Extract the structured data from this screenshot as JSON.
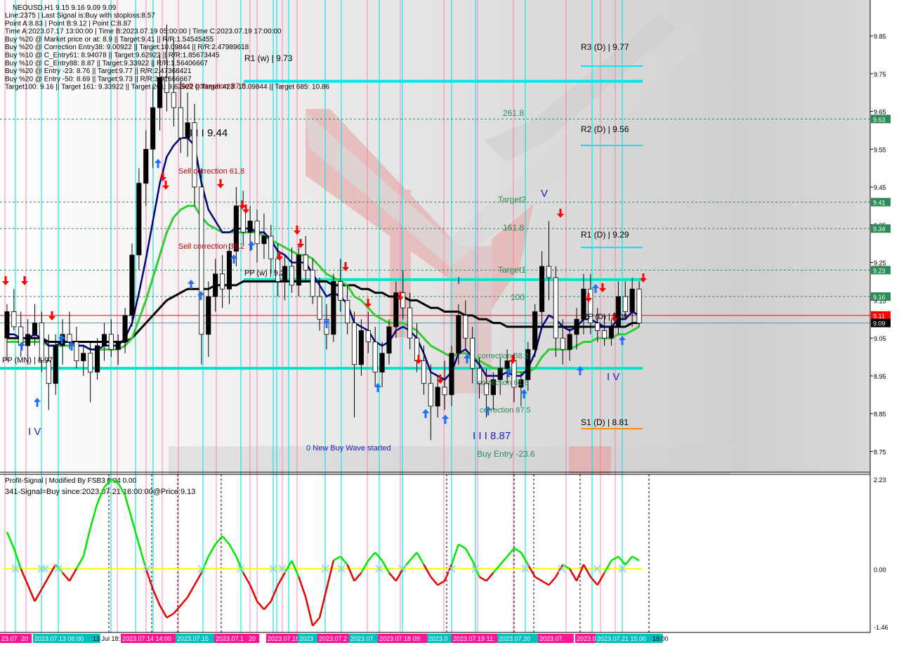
{
  "header": {
    "symbol_line": "NEOUSD,H1  9.15 9.16 9.09 9.09",
    "lines": [
      "Line:2375 | Last Signal is:Buy with stoploss:8.57",
      "Point A:8.83 | Point B:9.12 | Point C:8.87",
      "Time A:2023.07.17 13:00:00 | Time B:2023.07.19 05:00:00 | Time C:2023.07.19 17:00:00",
      "Buy %20 @ Market price or at: 8.9 || Target:9.41 || R/R:1.54545455",
      "Buy %20 @ Correction Entry38: 9.00922 || Target:10.09844 || R/R:2.47989618",
      "Buy %10 @ C_Entry61: 8.94078 || Target:9.62922 || R/R:1.85673445",
      "Buy %10 @ C_Entry88: 8.87 || Target:9.33922 || R/R:1.56406667",
      "Buy %20 @ Entry -23: 8.76 || Target:9.77 || R/R:2.47368421",
      "Buy %20 @ Entry -50: 8.69 || Target:9.73 || R/R:3.91666667",
      "Target100: 9.16 || Target 161: 9.33922 || Target 261: 9.62922 || Target 423: 10.09844 || Target 685: 10.86"
    ]
  },
  "colors": {
    "up": "#ff0000",
    "down": "#ffff00",
    "osc_zero": "#ffff00",
    "pivot": "#00e5ee",
    "pp_line": "#00e5c8",
    "ema_fast": "#000080",
    "ema_mid": "#32cd32",
    "ema_slow": "#000000",
    "fib": "#2e8b57",
    "cyan_vline": "#00e5ee",
    "pink_vline": "#ff69b4"
  },
  "price_axis": {
    "ticks": [
      "9.85",
      "9.75",
      "9.65",
      "9.55",
      "9.45",
      "9.35",
      "9.25",
      "9.15",
      "9.05",
      "8.95",
      "8.85",
      "8.75"
    ],
    "badges": [
      {
        "label": "9.63",
        "price": 9.63,
        "color": "#2e8b57"
      },
      {
        "label": "9.41",
        "price": 9.41,
        "color": "#2e8b57"
      },
      {
        "label": "9.34",
        "price": 9.34,
        "color": "#2e8b57"
      },
      {
        "label": "9.23",
        "price": 9.23,
        "color": "#2e8b57"
      },
      {
        "label": "9.16",
        "price": 9.16,
        "color": "#2e8b57"
      },
      {
        "label": "9.11",
        "price": 9.11,
        "color": "#ff0000"
      },
      {
        "label": "9.09",
        "price": 9.09,
        "color": "#000000"
      }
    ]
  },
  "levels": {
    "r3": "R3 (D) | 9.77",
    "r2": "R2 (D) | 9.56",
    "r1d": "R1 (D) | 9.29",
    "s1": "S1 (D) | 8.81",
    "r1w": "R1 (w) | 9.73",
    "pp_mn": "PP (MN) | 8.97",
    "pp_w": "PP (w) | 9.2",
    "pp_d": "PP (D) | 9.08"
  },
  "labels": {
    "fib261": "261.8",
    "target2": "Target2",
    "fib161": "161.8",
    "target1": "Target1",
    "fib100": "100",
    "wave_iii": "I I I 9.44",
    "wave_iii_b": "I I I 8.87",
    "wave_iv_left": "I V",
    "wave_iv_right": "I V",
    "wave_v": "V",
    "wave_i": "I",
    "sell_corr_875": "Sell correction 87.5",
    "sell_corr_618": "Sell correction 61.8",
    "sell_corr_382": "Sell correction 38.2",
    "corr_382": "correction 38.2",
    "corr_618": "correction 61.8",
    "corr_875": "correction 87.5",
    "new_wave": "0 New Buy Wave started",
    "buy_entry": "Buy Entry -23.6"
  },
  "oscillator": {
    "title": "Profit-Signal | Modified By FSB3 0.04 0.00",
    "signal": "341-Signal=Buy since:2023.07.21 16:00:00@Price:9.13",
    "ticks": [
      "2.23",
      "0.00",
      "-1.46"
    ]
  },
  "time_axis": [
    "23.07",
    "20",
    "2023.07.13 06:00",
    "13 Jul 18:",
    "2023.07.14 14:00",
    "2023.07.15",
    "2023.07.1",
    "20",
    "2023.07.16",
    "2023",
    "2023.07.2",
    "2023.07.",
    "2023.07.18 09:",
    "2023.0",
    "2023.07.19 11:",
    "2023.07.20",
    "2023.07.",
    "2023.07",
    "2023.07.21 15:00",
    "18:00"
  ],
  "chart_data": {
    "type": "candlestick",
    "ylim": [
      8.69,
      9.95
    ],
    "ohlc": [
      [
        9.05,
        9.14,
        8.99,
        9.12
      ],
      [
        9.12,
        9.18,
        9.07,
        9.08
      ],
      [
        9.08,
        9.12,
        9.0,
        9.03
      ],
      [
        9.03,
        9.1,
        8.98,
        9.06
      ],
      [
        9.06,
        9.14,
        9.03,
        9.09
      ],
      [
        9.09,
        9.12,
        8.96,
        8.99
      ],
      [
        8.99,
        9.06,
        8.86,
        8.93
      ],
      [
        8.93,
        9.06,
        8.9,
        9.03
      ],
      [
        9.03,
        9.1,
        8.98,
        9.06
      ],
      [
        9.06,
        9.12,
        9.02,
        9.04
      ],
      [
        9.04,
        9.08,
        8.97,
        8.99
      ],
      [
        8.99,
        9.03,
        8.95,
        9.01
      ],
      [
        9.01,
        9.04,
        8.88,
        8.96
      ],
      [
        8.96,
        9.05,
        8.94,
        9.03
      ],
      [
        9.03,
        9.09,
        8.99,
        9.06
      ],
      [
        9.06,
        9.1,
        9.0,
        9.02
      ],
      [
        9.02,
        9.06,
        8.98,
        9.04
      ],
      [
        9.04,
        9.13,
        9.01,
        9.11
      ],
      [
        9.11,
        9.3,
        9.08,
        9.27
      ],
      [
        9.27,
        9.5,
        9.23,
        9.46
      ],
      [
        9.46,
        9.6,
        9.4,
        9.55
      ],
      [
        9.55,
        9.72,
        9.5,
        9.66
      ],
      [
        9.66,
        9.8,
        9.6,
        9.74
      ],
      [
        9.74,
        9.88,
        9.65,
        9.7
      ],
      [
        9.7,
        9.84,
        9.61,
        9.66
      ],
      [
        9.66,
        9.73,
        9.54,
        9.58
      ],
      [
        9.58,
        9.7,
        9.53,
        9.62
      ],
      [
        9.62,
        9.67,
        9.4,
        9.45
      ],
      [
        9.45,
        9.5,
        8.98,
        9.06
      ],
      [
        9.06,
        9.2,
        9.0,
        9.16
      ],
      [
        9.16,
        9.26,
        9.12,
        9.22
      ],
      [
        9.22,
        9.27,
        9.13,
        9.18
      ],
      [
        9.18,
        9.3,
        9.14,
        9.28
      ],
      [
        9.28,
        9.45,
        9.24,
        9.4
      ],
      [
        9.4,
        9.44,
        9.3,
        9.33
      ],
      [
        9.33,
        9.4,
        9.28,
        9.36
      ],
      [
        9.36,
        9.39,
        9.25,
        9.3
      ],
      [
        9.3,
        9.38,
        9.26,
        9.32
      ],
      [
        9.32,
        9.35,
        9.22,
        9.26
      ],
      [
        9.26,
        9.3,
        9.16,
        9.2
      ],
      [
        9.2,
        9.27,
        9.15,
        9.24
      ],
      [
        9.24,
        9.29,
        9.17,
        9.19
      ],
      [
        9.19,
        9.3,
        9.16,
        9.27
      ],
      [
        9.27,
        9.32,
        9.2,
        9.23
      ],
      [
        9.23,
        9.26,
        9.14,
        9.16
      ],
      [
        9.16,
        9.21,
        9.07,
        9.1
      ],
      [
        9.1,
        9.14,
        9.02,
        9.06
      ],
      [
        9.06,
        9.22,
        9.04,
        9.2
      ],
      [
        9.2,
        9.26,
        9.12,
        9.15
      ],
      [
        9.15,
        9.19,
        9.06,
        9.09
      ],
      [
        9.09,
        9.12,
        8.84,
        8.98
      ],
      [
        8.98,
        9.1,
        8.95,
        9.07
      ],
      [
        9.07,
        9.12,
        9.01,
        9.04
      ],
      [
        9.04,
        9.08,
        8.92,
        8.96
      ],
      [
        8.96,
        9.04,
        8.92,
        9.01
      ],
      [
        9.01,
        9.1,
        8.98,
        9.08
      ],
      [
        9.08,
        9.2,
        9.05,
        9.17
      ],
      [
        9.17,
        9.23,
        9.1,
        9.13
      ],
      [
        9.13,
        9.17,
        9.02,
        9.05
      ],
      [
        9.05,
        9.09,
        8.96,
        8.99
      ],
      [
        8.99,
        9.03,
        8.9,
        8.93
      ],
      [
        8.93,
        8.98,
        8.78,
        8.87
      ],
      [
        8.87,
        8.95,
        8.84,
        8.92
      ],
      [
        8.92,
        8.99,
        8.86,
        8.9
      ],
      [
        8.9,
        9.03,
        8.87,
        9.01
      ],
      [
        9.01,
        9.14,
        8.98,
        9.11
      ],
      [
        9.11,
        9.15,
        9.02,
        9.05
      ],
      [
        9.05,
        9.08,
        8.93,
        8.97
      ],
      [
        8.97,
        9.0,
        8.89,
        8.93
      ],
      [
        8.93,
        8.97,
        8.84,
        8.9
      ],
      [
        8.9,
        8.96,
        8.86,
        8.94
      ],
      [
        8.94,
        9.0,
        8.9,
        8.97
      ],
      [
        8.97,
        9.02,
        8.93,
        8.99
      ],
      [
        8.99,
        9.01,
        8.88,
        8.92
      ],
      [
        8.92,
        8.96,
        8.87,
        8.94
      ],
      [
        8.94,
        9.04,
        8.91,
        9.02
      ],
      [
        9.02,
        9.14,
        9.0,
        9.12
      ],
      [
        9.12,
        9.28,
        9.08,
        9.24
      ],
      [
        9.24,
        9.36,
        9.15,
        9.21
      ],
      [
        9.21,
        9.24,
        9.0,
        9.05
      ],
      [
        9.05,
        9.1,
        8.98,
        9.02
      ],
      [
        9.02,
        9.08,
        8.99,
        9.06
      ],
      [
        9.06,
        9.13,
        9.02,
        9.1
      ],
      [
        9.1,
        9.22,
        9.06,
        9.18
      ],
      [
        9.18,
        9.22,
        9.06,
        9.09
      ],
      [
        9.09,
        9.13,
        9.04,
        9.07
      ],
      [
        9.07,
        9.11,
        9.03,
        9.05
      ],
      [
        9.05,
        9.1,
        9.03,
        9.08
      ],
      [
        9.08,
        9.2,
        9.06,
        9.16
      ],
      [
        9.16,
        9.2,
        9.1,
        9.12
      ],
      [
        9.12,
        9.21,
        9.08,
        9.18
      ],
      [
        9.18,
        9.2,
        9.08,
        9.09
      ]
    ],
    "series": [
      {
        "name": "ema_fast",
        "values": [
          9.06,
          9.06,
          9.05,
          9.05,
          9.06,
          9.05,
          9.03,
          9.03,
          9.04,
          9.04,
          9.03,
          9.03,
          9.02,
          9.02,
          9.03,
          9.03,
          9.03,
          9.05,
          9.09,
          9.17,
          9.26,
          9.36,
          9.46,
          9.53,
          9.56,
          9.58,
          9.58,
          9.56,
          9.46,
          9.39,
          9.36,
          9.33,
          9.33,
          9.34,
          9.34,
          9.34,
          9.33,
          9.33,
          9.31,
          9.28,
          9.27,
          9.25,
          9.25,
          9.25,
          9.22,
          9.19,
          9.16,
          9.17,
          9.16,
          9.14,
          9.09,
          9.08,
          9.07,
          9.04,
          9.03,
          9.04,
          9.07,
          9.08,
          9.07,
          9.05,
          9.01,
          8.96,
          8.95,
          8.94,
          8.96,
          9.01,
          9.02,
          9.0,
          8.98,
          8.95,
          8.95,
          8.95,
          8.96,
          8.95,
          8.95,
          8.97,
          9.01,
          9.08,
          9.11,
          9.1,
          9.08,
          9.07,
          9.08,
          9.1,
          9.1,
          9.09,
          9.08,
          9.08,
          9.1,
          9.1,
          9.12,
          9.11
        ]
      },
      {
        "name": "ema_mid",
        "values": [
          9.04,
          9.04,
          9.04,
          9.04,
          9.04,
          9.04,
          9.03,
          9.03,
          9.03,
          9.03,
          9.03,
          9.03,
          9.02,
          9.02,
          9.02,
          9.02,
          9.02,
          9.03,
          9.05,
          9.1,
          9.15,
          9.21,
          9.27,
          9.33,
          9.37,
          9.39,
          9.4,
          9.4,
          9.37,
          9.35,
          9.34,
          9.33,
          9.33,
          9.33,
          9.33,
          9.33,
          9.33,
          9.32,
          9.31,
          9.3,
          9.29,
          9.28,
          9.27,
          9.27,
          9.26,
          9.24,
          9.22,
          9.21,
          9.2,
          9.19,
          9.16,
          9.15,
          9.13,
          9.11,
          9.1,
          9.09,
          9.09,
          9.09,
          9.08,
          9.07,
          9.05,
          9.03,
          9.02,
          9.01,
          9.0,
          9.01,
          9.01,
          9.0,
          8.99,
          8.98,
          8.97,
          8.97,
          8.97,
          8.96,
          8.96,
          8.96,
          8.97,
          9.0,
          9.02,
          9.02,
          9.02,
          9.02,
          9.03,
          9.04,
          9.04,
          9.05,
          9.05,
          9.05,
          9.06,
          9.06,
          9.07,
          9.08
        ]
      },
      {
        "name": "ema_slow",
        "values": [
          9.05,
          9.05,
          9.05,
          9.05,
          9.05,
          9.05,
          9.04,
          9.04,
          9.04,
          9.04,
          9.04,
          9.04,
          9.04,
          9.04,
          9.04,
          9.04,
          9.04,
          9.04,
          9.05,
          9.07,
          9.09,
          9.11,
          9.13,
          9.15,
          9.16,
          9.17,
          9.18,
          9.18,
          9.18,
          9.18,
          9.19,
          9.19,
          9.19,
          9.19,
          9.2,
          9.2,
          9.2,
          9.2,
          9.2,
          9.2,
          9.2,
          9.2,
          9.2,
          9.2,
          9.2,
          9.2,
          9.2,
          9.19,
          9.19,
          9.19,
          9.19,
          9.18,
          9.18,
          9.17,
          9.17,
          9.16,
          9.16,
          9.16,
          9.15,
          9.15,
          9.14,
          9.13,
          9.13,
          9.12,
          9.12,
          9.12,
          9.11,
          9.11,
          9.1,
          9.1,
          9.09,
          9.09,
          9.08,
          9.08,
          9.08,
          9.08,
          9.08,
          9.08,
          9.08,
          9.08,
          9.08,
          9.08,
          9.08,
          9.08,
          9.08,
          9.08,
          9.08,
          9.08,
          9.08,
          9.08,
          9.09,
          9.09
        ]
      }
    ],
    "oscillator": [
      0.9,
      0.5,
      0.0,
      -0.4,
      -0.8,
      -0.5,
      -0.2,
      0.1,
      -0.1,
      -0.3,
      0.0,
      0.3,
      1.0,
      1.6,
      2.0,
      2.2,
      2.1,
      1.8,
      1.2,
      0.6,
      0.0,
      -0.5,
      -0.9,
      -1.2,
      -1.1,
      -0.9,
      -0.7,
      -0.4,
      -0.1,
      0.3,
      0.6,
      0.8,
      0.6,
      0.3,
      -0.1,
      -0.4,
      -0.8,
      -1.0,
      -0.8,
      -0.4,
      -0.1,
      0.2,
      -0.2,
      -0.7,
      -1.4,
      -1.2,
      -0.5,
      0.2,
      0.3,
      0.1,
      -0.3,
      -0.1,
      0.2,
      0.4,
      0.2,
      -0.1,
      -0.3,
      0.0,
      0.2,
      0.4,
      0.1,
      -0.2,
      -0.4,
      -0.3,
      0.1,
      0.6,
      0.5,
      0.2,
      -0.2,
      -0.3,
      -0.1,
      0.1,
      0.3,
      0.5,
      0.4,
      0.1,
      -0.2,
      -0.3,
      -0.4,
      -0.2,
      0.1,
      0.0,
      -0.3,
      0.1,
      -0.2,
      -0.4,
      -0.1,
      0.2,
      0.3,
      0.1,
      0.3,
      0.2
    ]
  }
}
